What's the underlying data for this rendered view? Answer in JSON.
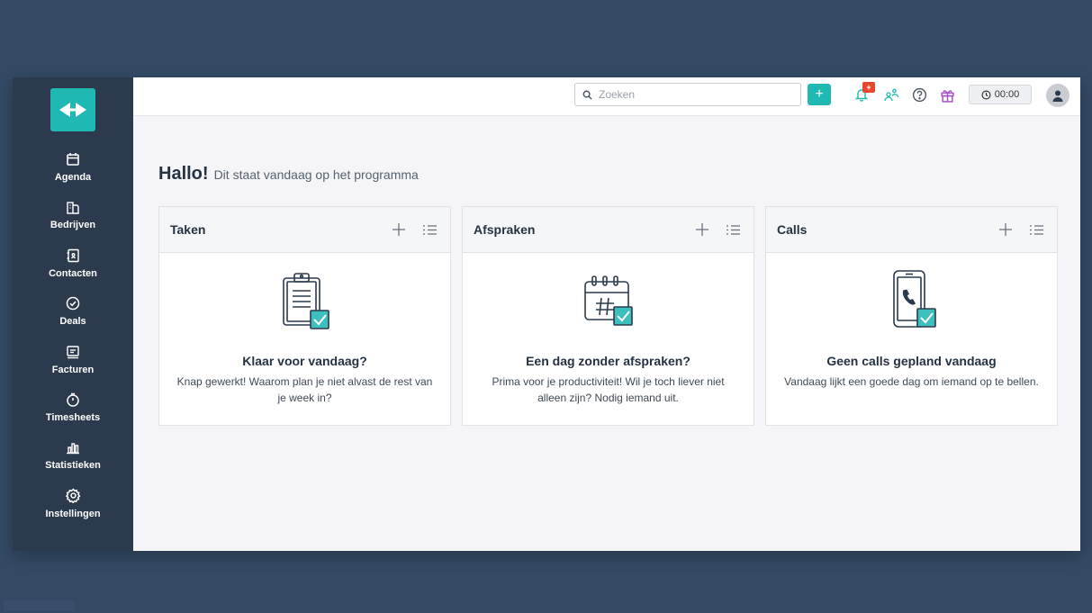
{
  "sidebar": {
    "items": [
      {
        "label": "Agenda",
        "icon": "calendar-icon"
      },
      {
        "label": "Bedrijven",
        "icon": "buildings-icon"
      },
      {
        "label": "Contacten",
        "icon": "contact-book-icon"
      },
      {
        "label": "Deals",
        "icon": "check-circle-icon"
      },
      {
        "label": "Facturen",
        "icon": "invoice-icon"
      },
      {
        "label": "Timesheets",
        "icon": "stopwatch-icon"
      },
      {
        "label": "Statistieken",
        "icon": "bar-chart-icon"
      },
      {
        "label": "Instellingen",
        "icon": "gear-icon"
      }
    ]
  },
  "header": {
    "search_placeholder": "Zoeken",
    "add_label": "+",
    "timer": "00:00",
    "notification_badge": "+"
  },
  "main": {
    "greeting_title": "Hallo!",
    "greeting_sub": "Dit staat vandaag op het programma"
  },
  "cards": [
    {
      "title": "Taken",
      "heading": "Klaar voor vandaag?",
      "text": "Knap gewerkt! Waarom plan je niet alvast de rest van je week in?"
    },
    {
      "title": "Afspraken",
      "heading": "Een dag zonder afspraken?",
      "text": "Prima voor je productiviteit! Wil je toch liever niet alleen zijn? Nodig iemand uit."
    },
    {
      "title": "Calls",
      "heading": "Geen calls gepland vandaag",
      "text": "Vandaag lijkt een goede dag om iemand op te bellen."
    }
  ],
  "colors": {
    "accent": "#1fb8b3",
    "sidebar": "#2b3a4c",
    "background": "#334a64",
    "badge": "#e5482e"
  }
}
